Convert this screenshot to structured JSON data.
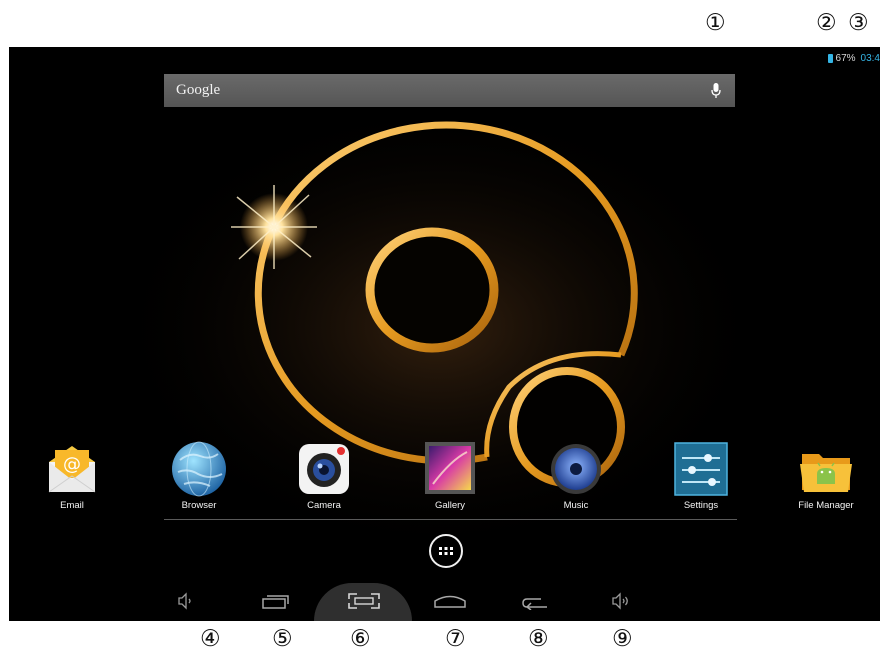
{
  "callouts": {
    "c1": "①",
    "c2": "②",
    "c3": "③",
    "c4": "④",
    "c5": "⑤",
    "c6": "⑥",
    "c7": "⑦",
    "c8": "⑧",
    "c9": "⑨"
  },
  "status_bar": {
    "battery": "67%",
    "time": "03:4",
    "accent_color": "#35b5e5"
  },
  "search": {
    "label": "Google",
    "mic_icon": "microphone-icon"
  },
  "apps": [
    {
      "label": "Email",
      "icon": "email-icon"
    },
    {
      "label": "Browser",
      "icon": "globe-icon"
    },
    {
      "label": "Camera",
      "icon": "camera-icon"
    },
    {
      "label": "Gallery",
      "icon": "gallery-icon"
    },
    {
      "label": "Music",
      "icon": "speaker-icon"
    },
    {
      "label": "Settings",
      "icon": "settings-sliders-icon"
    },
    {
      "label": "File Manager",
      "icon": "folder-android-icon"
    }
  ],
  "app_drawer_icon": "app-grid-icon",
  "nav_bar": {
    "items": [
      "volume-down-icon",
      "recent-apps-icon",
      "screenshot-icon",
      "home-icon",
      "back-icon",
      "volume-up-icon"
    ]
  }
}
